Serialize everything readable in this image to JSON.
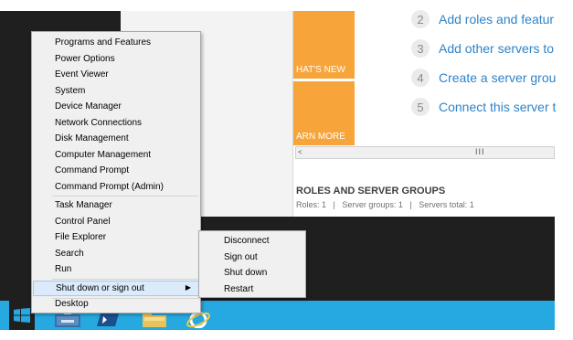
{
  "server_manager": {
    "steps": [
      {
        "num": "2",
        "label": "Add roles and featur"
      },
      {
        "num": "3",
        "label": "Add other servers to"
      },
      {
        "num": "4",
        "label": "Create a server grou"
      },
      {
        "num": "5",
        "label": "Connect this server t"
      }
    ],
    "tiles": {
      "whats_new": "HAT'S NEW",
      "learn_more": "ARN MORE"
    },
    "scrollbar": {
      "left_arrow": "<",
      "grip": "III"
    },
    "roles": {
      "title": "ROLES AND SERVER GROUPS",
      "stats": "Roles: 1   |   Server groups: 1   |   Servers total: 1"
    },
    "colors": {
      "tile": "#f7a43a",
      "link": "#2e83c9",
      "taskbar": "#25a9e0"
    }
  },
  "winx_menu": {
    "group1": [
      "Programs and Features",
      "Power Options",
      "Event Viewer",
      "System",
      "Device Manager",
      "Network Connections",
      "Disk Management",
      "Computer Management",
      "Command Prompt",
      "Command Prompt (Admin)"
    ],
    "group2": [
      "Task Manager",
      "Control Panel",
      "File Explorer",
      "Search",
      "Run"
    ],
    "shutdown": "Shut down or sign out",
    "desktop": "Desktop"
  },
  "submenu": [
    "Disconnect",
    "Sign out",
    "Shut down",
    "Restart"
  ],
  "taskbar": {
    "icons": [
      "windows-logo-icon",
      "server-manager-icon",
      "powershell-icon",
      "file-explorer-icon",
      "internet-explorer-icon"
    ]
  }
}
